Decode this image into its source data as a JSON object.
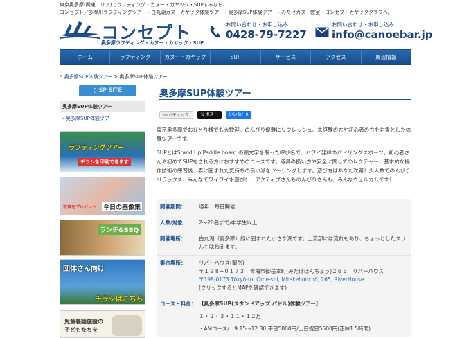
{
  "header": {
    "intro_line1": "東京奥多摩(関東エリア)でラフティング・カヌー・カヤック・SUPするなら、",
    "intro_line2": "コンセプト／多摩川ラフティングツアー・白丸湖カヌーカヤック体験ツアー・奥多摩SUP体験ツアー・みたけカヌー教室・コンセプトカヤッククラブへ。",
    "logo_title": "コンセプト",
    "logo_sub": "奥多摩ラフティング・カヌー・カヤック・SUP",
    "phone_label": "お問い合わせ・お申し込み",
    "phone_number": "0428-79-7227",
    "mail_label": "お問い合わせ・お申し込み",
    "mail_address": "info@canoebar.jp"
  },
  "nav": {
    "items": [
      "ホーム",
      "ラフティング",
      "カヌー・カヤック",
      "SUP",
      "サービス",
      "アクセス",
      "周辺情報"
    ]
  },
  "breadcrumb": {
    "home": "奥多摩SUP体験ツアー",
    "separator": ">",
    "current": "奥多摩SUP体験ツアー"
  },
  "sidebar": {
    "sp_site": "SP SITE",
    "section_title": "奥多摩SUP体験ツアー",
    "active_item": "奥多摩SUP体験ツアー",
    "banners": {
      "rafting_text": "ラフティングツアー",
      "rafting_sub": "チラシを印刷できます",
      "gallery_sub": "写真をプレゼント",
      "gallery_text": "今日の画像集",
      "lunch_text": "ランチ&BBQ",
      "group_text": "団体さん向け",
      "group_sub": "チラシはこちら",
      "children_line1": "児童養護施設の",
      "children_line2": "子どもたちを"
    }
  },
  "main": {
    "title": "奥多摩SUP体験ツアー",
    "social": {
      "mixi": "mixiチェック",
      "tweet": "ポスト",
      "like": "いいね！0"
    },
    "intro_p1": "東京奥多摩でおひとり様でも大歓迎。のんびり優雅にリフレッシュ。未経験の方や初心者の方を対象とした体験ツアーです。",
    "intro_p2": "SUPとはStand Up Paddle board の頭文字を取った呼び名で、ハワイ発祥のパドリングスポーツ。初心者さんや初めてSUPをされる方におすすめのコースです。道具の扱い方や安全に関してのレクチャー、基本的な操作技術の練習後、森に囲まれた気持ちの良い湖をツーリングします。遊び方はあなた次第！少人数でのんびりリラックス、みんなでワイワイ水遊び！！アクティブさんものんびりさんも、みんなウェルカムです！",
    "info": {
      "period_label": "開催期間：",
      "period_value": "通年　毎日開催",
      "people_label": "人数/対象：",
      "people_value": "2〜20名まで/中学生以上",
      "place_label": "開催場所：",
      "place_value": "白丸湖（奥多摩）緑に囲まれた小さな湖です。上流部には流れもあり、ちょっとしたスリルも味わえます。",
      "meet_label": "集合場所：",
      "meet_name": "リバーハウス(御岳)",
      "meet_address": "〒１９８−０１７３　青梅市御岳本町(みたけほんちょう)２６５　リバーハウス",
      "meet_link": "〒198-0173 Tōkyō-to, Ōme-shi, Mitakehonchō, 265, RiverHouse",
      "meet_note": "(クリックするとMAPを確認できます)",
      "course_label": "コース・料金：",
      "course_title": "【奥多摩SUP(スタンドアップ パドル)体験ツアー】",
      "course_months": "１・２・３・１１・１２月",
      "course_am": "・AMコース/　9:15〜12:30 平日5000円/土日祝日5500円(正味1.5時間)"
    }
  },
  "colors": {
    "brand": "#1d4d8f",
    "nav_bg": "#1d5a9c",
    "sp_button": "#3a8fd0"
  }
}
